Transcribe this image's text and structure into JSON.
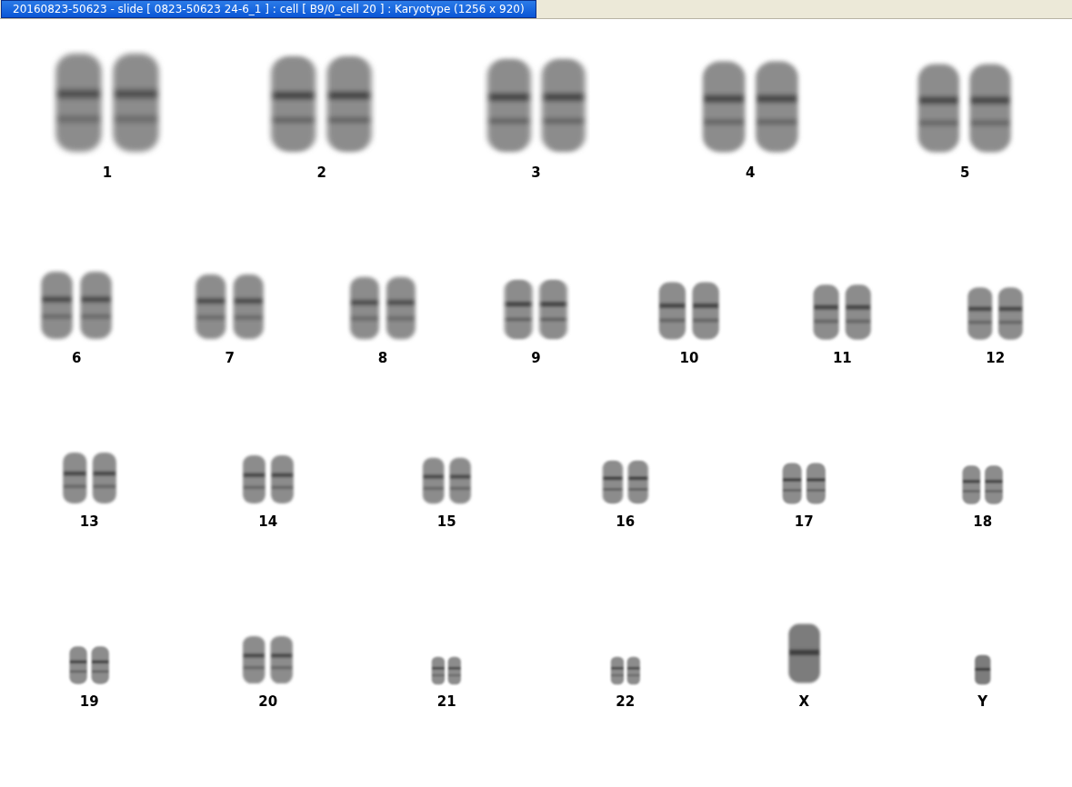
{
  "window": {
    "title": "20160823-50623 - slide [ 0823-50623 24-6_1 ] : cell [ B9/0_cell 20 ] : Karyotype  (1256 x 920)"
  },
  "karyotype": {
    "rows": [
      [
        {
          "label": "1",
          "kind": "pair"
        },
        {
          "label": "2",
          "kind": "pair"
        },
        {
          "label": "3",
          "kind": "pair"
        },
        {
          "label": "4",
          "kind": "pair"
        },
        {
          "label": "5",
          "kind": "pair"
        }
      ],
      [
        {
          "label": "6",
          "kind": "pair"
        },
        {
          "label": "7",
          "kind": "pair"
        },
        {
          "label": "8",
          "kind": "pair"
        },
        {
          "label": "9",
          "kind": "pair"
        },
        {
          "label": "10",
          "kind": "pair"
        },
        {
          "label": "11",
          "kind": "pair"
        },
        {
          "label": "12",
          "kind": "pair"
        }
      ],
      [
        {
          "label": "13",
          "kind": "pair"
        },
        {
          "label": "14",
          "kind": "pair"
        },
        {
          "label": "15",
          "kind": "pair"
        },
        {
          "label": "16",
          "kind": "pair"
        },
        {
          "label": "17",
          "kind": "pair"
        },
        {
          "label": "18",
          "kind": "pair"
        }
      ],
      [
        {
          "label": "19",
          "kind": "pair"
        },
        {
          "label": "20",
          "kind": "pair"
        },
        {
          "label": "21",
          "kind": "pair"
        },
        {
          "label": "22",
          "kind": "pair"
        },
        {
          "label": "X",
          "kind": "single"
        },
        {
          "label": "Y",
          "kind": "single"
        }
      ]
    ]
  }
}
